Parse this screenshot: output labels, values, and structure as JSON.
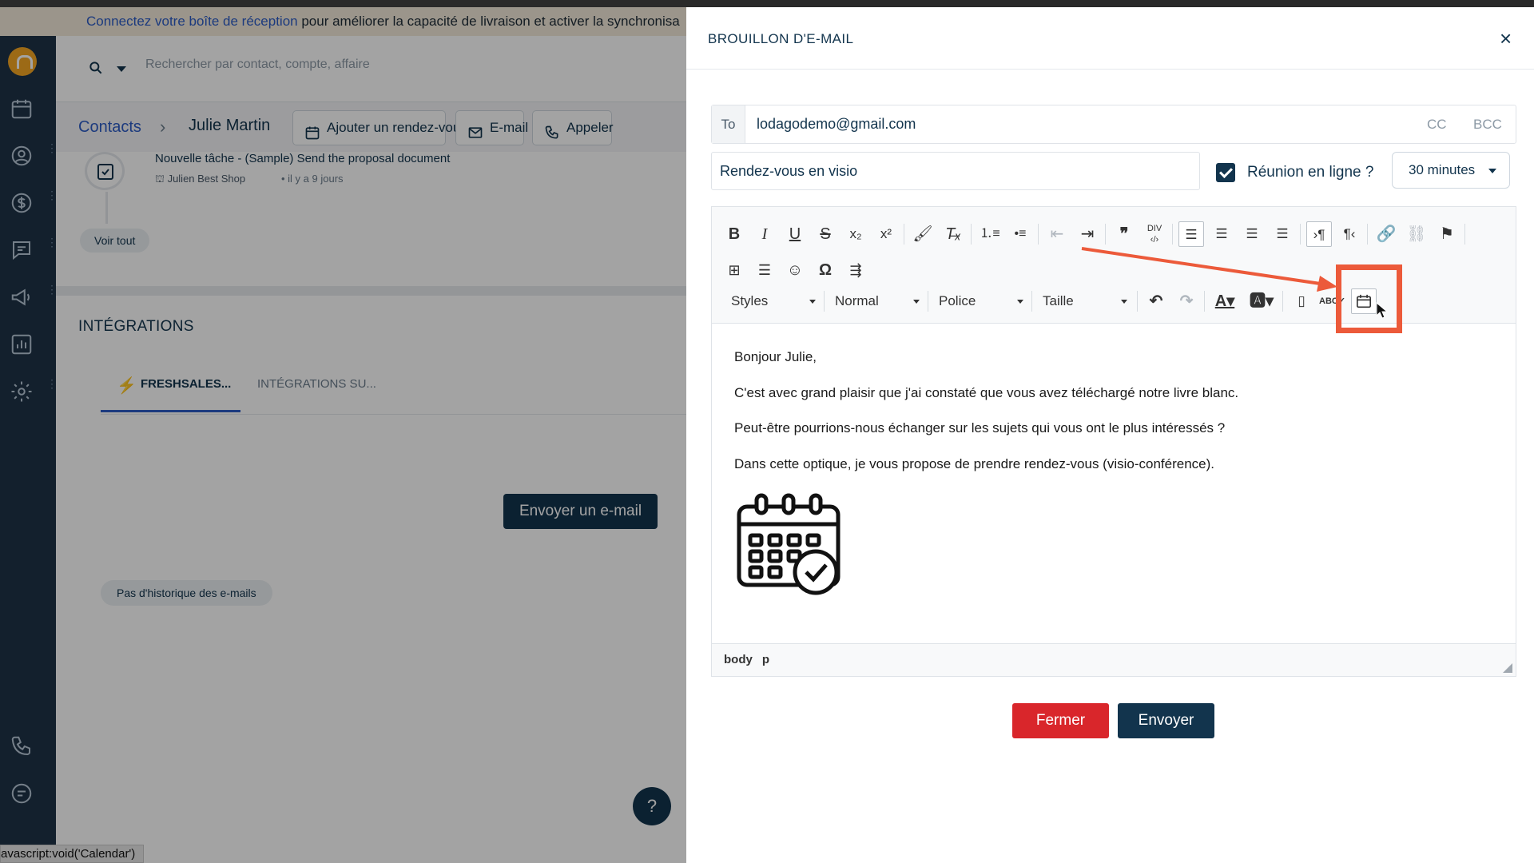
{
  "banner": {
    "link_text": "Connectez votre boîte de réception",
    "text": " pour améliorer la capacité de livraison et activer la synchronisa"
  },
  "search": {
    "placeholder": "Rechercher par contact, compte, affaire"
  },
  "breadcrumb": {
    "root": "Contacts",
    "separator": "›",
    "current": "Julie Martin"
  },
  "header_actions": [
    {
      "label": "Ajouter un rendez-vous",
      "icon": "calendar-icon"
    },
    {
      "label": "E-mail",
      "icon": "mail-icon"
    },
    {
      "label": "Appeler",
      "icon": "phone-icon"
    }
  ],
  "activity": {
    "task_title": "Nouvelle tâche - (Sample) Send the proposal document",
    "task_account": "Julien Best Shop",
    "task_time": "il y a 9 jours",
    "see_all": "Voir tout"
  },
  "integrations": {
    "title": "INTÉGRATIONS",
    "tabs": [
      "FRESHSALES...",
      "INTÉGRATIONS SU..."
    ],
    "send_email_button": "Envoyer un e-mail",
    "empty_state": "Pas d'historique des e-mails",
    "help": "?"
  },
  "status_tip": "avascript:void('Calendar')",
  "modal": {
    "title": "BROUILLON D'E-MAIL",
    "close": "×",
    "to_label": "To",
    "to_value": "lodagodemo@gmail.com",
    "cc": "CC",
    "bcc": "BCC",
    "subject": "Rendez-vous en visio",
    "online_meeting_label": "Réunion en ligne ?",
    "online_meeting_checked": true,
    "duration": "30 minutes",
    "toolbar": {
      "styles": "Styles",
      "format": "Normal",
      "font": "Police",
      "size": "Taille",
      "bold": "B",
      "italic": "I",
      "underline": "U",
      "strike": "S",
      "highlighted_button": "calendar-insert-icon"
    },
    "body_paragraphs": [
      "Bonjour Julie,",
      "C'est avec grand plaisir que j'ai constaté que vous avez téléchargé notre livre blanc.",
      "Peut-être pourrions-nous échanger sur les sujets qui vous ont le plus intéressés ?",
      "Dans cette optique, je vous propose de prendre rendez-vous (visio-conférence)."
    ],
    "path": [
      "body",
      "p"
    ],
    "btn_close": "Fermer",
    "btn_send": "Envoyer"
  },
  "colors": {
    "accent": "#12344d",
    "danger": "#d9262b",
    "highlight": "#ec5a3a",
    "link": "#2c5cc5",
    "sidebar": "#1e3347"
  }
}
